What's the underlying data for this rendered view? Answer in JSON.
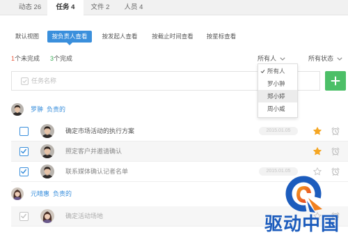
{
  "colors": {
    "accent": "#3a8fdc",
    "add_button": "#4cbf67",
    "incomplete": "#e8573c",
    "complete": "#3fae5a",
    "star": "#f5a623",
    "watermark": "#1c5cbd"
  },
  "tabs": [
    {
      "label": "动态",
      "count": "26",
      "active": false
    },
    {
      "label": "任务",
      "count": "4",
      "active": true
    },
    {
      "label": "文件",
      "count": "2",
      "active": false
    },
    {
      "label": "人员",
      "count": "4",
      "active": false
    }
  ],
  "views": [
    {
      "label": "默认视图",
      "active": false
    },
    {
      "label": "按负责人查看",
      "active": true
    },
    {
      "label": "按发起人查看",
      "active": false
    },
    {
      "label": "按截止时间查看",
      "active": false
    },
    {
      "label": "按星标查看",
      "active": false
    }
  ],
  "summary": {
    "incomplete_count": "1",
    "incomplete_label": "个未完成",
    "complete_count": "3",
    "complete_label": "个完成"
  },
  "filters": {
    "people": "所有人",
    "status": "所有状态"
  },
  "people_menu": {
    "open": true,
    "items": [
      {
        "label": "所有人",
        "selected": true,
        "hovered": false
      },
      {
        "label": "罗小翀",
        "selected": false,
        "hovered": false
      },
      {
        "label": "郑小婷",
        "selected": false,
        "hovered": true
      },
      {
        "label": "周小威",
        "selected": false,
        "hovered": false
      }
    ]
  },
  "new_task": {
    "placeholder": "任务名称",
    "add_icon": "plus-icon"
  },
  "groups": [
    {
      "owner": "罗翀",
      "suffix": "负责的",
      "tasks": [
        {
          "title": "确定市场活动的执行方案",
          "done": false,
          "due": "2015.01.05",
          "starred": true
        },
        {
          "title": "照定客户并邀请确认",
          "done": true,
          "starred": true
        },
        {
          "title": "联系媒体确认记者名单",
          "done": true,
          "due": "2015.01.05",
          "starred": false
        }
      ]
    },
    {
      "owner": "元晴惠",
      "suffix": "负责的",
      "tasks": [
        {
          "title": "确定活动场地",
          "done": true,
          "starred": false
        }
      ]
    }
  ],
  "watermark": {
    "text": "驱动中国"
  }
}
